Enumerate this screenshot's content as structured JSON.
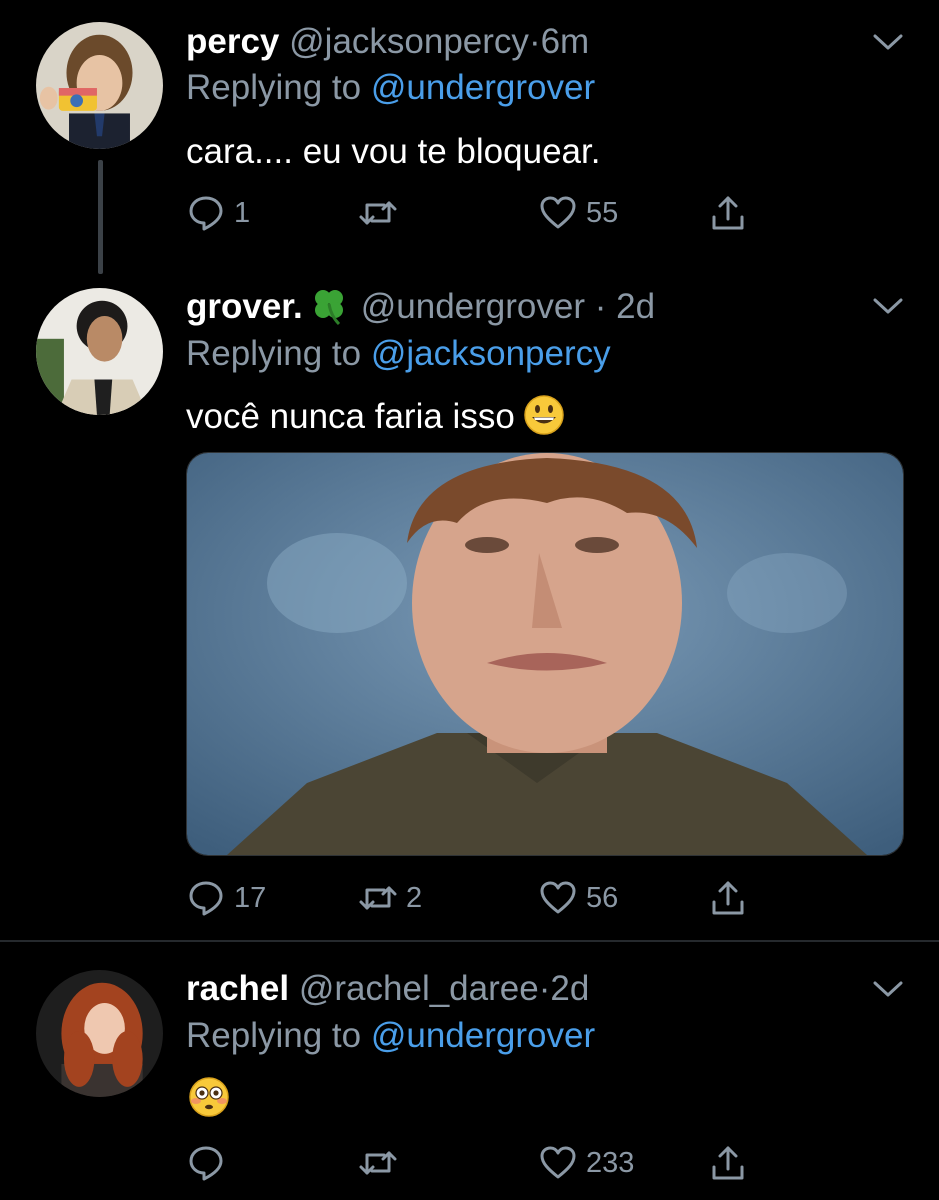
{
  "tweets": [
    {
      "name": "percy",
      "handle": "@jacksonpercy",
      "dot": "·",
      "time": "6m",
      "replying_prefix": "Replying to",
      "replying_to": "@undergrover",
      "text": "cara.... eu vou te bloquear.",
      "actions": {
        "reply_count": "1",
        "retweet_count": "",
        "like_count": "55"
      }
    },
    {
      "name": "grover.",
      "name_emoji": "four-leaf-clover-icon",
      "handle": "@undergrover",
      "dot": "·",
      "time": "2d",
      "replying_prefix": "Replying to",
      "replying_to": "@jacksonpercy",
      "text": "você nunca faria isso",
      "text_emoji": "smiley-face-icon",
      "has_media": true,
      "actions": {
        "reply_count": "17",
        "retweet_count": "2",
        "like_count": "56"
      }
    },
    {
      "name": "rachel",
      "handle": "@rachel_daree",
      "dot": "·",
      "time": "2d",
      "replying_prefix": "Replying to",
      "replying_to": "@undergrover",
      "text_emoji": "flushed-face-icon",
      "actions": {
        "reply_count": "",
        "retweet_count": "",
        "like_count": "233"
      }
    }
  ],
  "colors": {
    "background": "#000000",
    "text_primary": "#ffffff",
    "text_secondary": "#8b98a5",
    "link": "#4a9ee9",
    "divider": "#25292d"
  }
}
